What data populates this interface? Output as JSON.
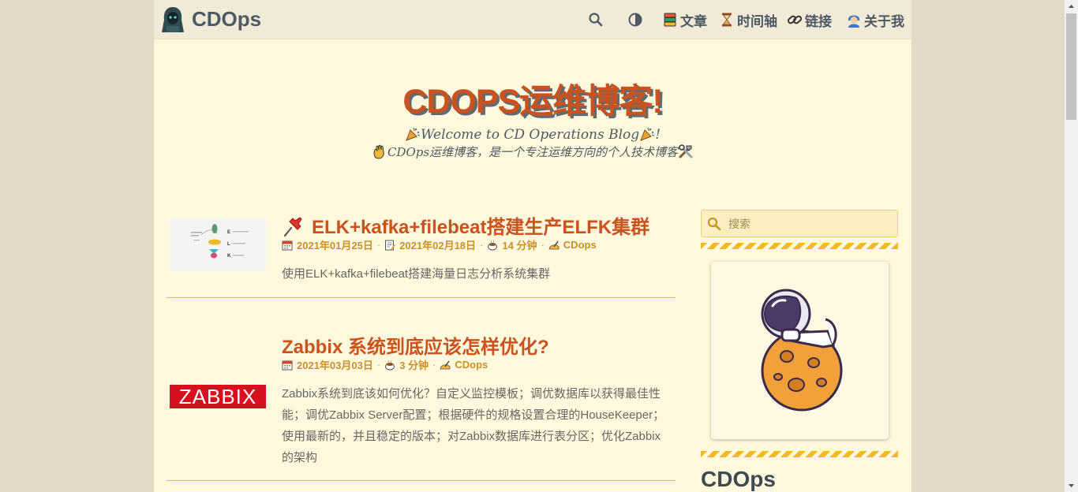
{
  "header": {
    "brand": "CDOps",
    "nav": [
      {
        "label": "文章",
        "icon": "books-icon"
      },
      {
        "label": "时间轴",
        "icon": "hourglass-icon"
      },
      {
        "label": "链接",
        "icon": "link-icon"
      },
      {
        "label": "关于我",
        "icon": "user-icon"
      }
    ],
    "search_icon": "search-icon",
    "theme_icon": "contrast-icon"
  },
  "hero": {
    "title": "CDOPS运维博客!",
    "subtitle_1": "Welcome to CD Operations Blog",
    "subtitle_1_end": "!",
    "subtitle_2": "CDOps运维博客，是一个专注运维方向的个人技术博客"
  },
  "posts": [
    {
      "title": "ELK+kafka+filebeat搭建生产ELFK集群",
      "pinned": true,
      "published": "2021年01月25日",
      "updated": "2021年02月18日",
      "read_time": "14 分钟",
      "author": "CDops",
      "excerpt": "使用ELK+kafka+filebeat搭建海量日志分析系统集群",
      "thumb": "elk-thumbnail",
      "thumb_labels": [
        "E",
        "L",
        "K"
      ]
    },
    {
      "title": "Zabbix 系统到底应该怎样优化?",
      "pinned": false,
      "published": "2021年03月03日",
      "read_time": "3 分钟",
      "author": "CDops",
      "excerpt": "Zabbix系统到底该如何优化？自定义监控模板；调优数据库以获得最佳性能；调优Zabbix Server配置；根据硬件的规格设置合理的HouseKeeper；使用最新的，并且稳定的版本；对Zabbix数据库进行表分区；优化Zabbix的架构",
      "thumb": "zabbix-logo",
      "thumb_text": "ZABBIX"
    }
  ],
  "sidebar": {
    "search_placeholder": "搜索",
    "name": "CDOps"
  },
  "colors": {
    "accent": "#c9521e",
    "meta": "#c9912a",
    "page_bg": "#fff8dc",
    "outer_bg": "#e2d9c7",
    "stripe": "#f1b928"
  }
}
